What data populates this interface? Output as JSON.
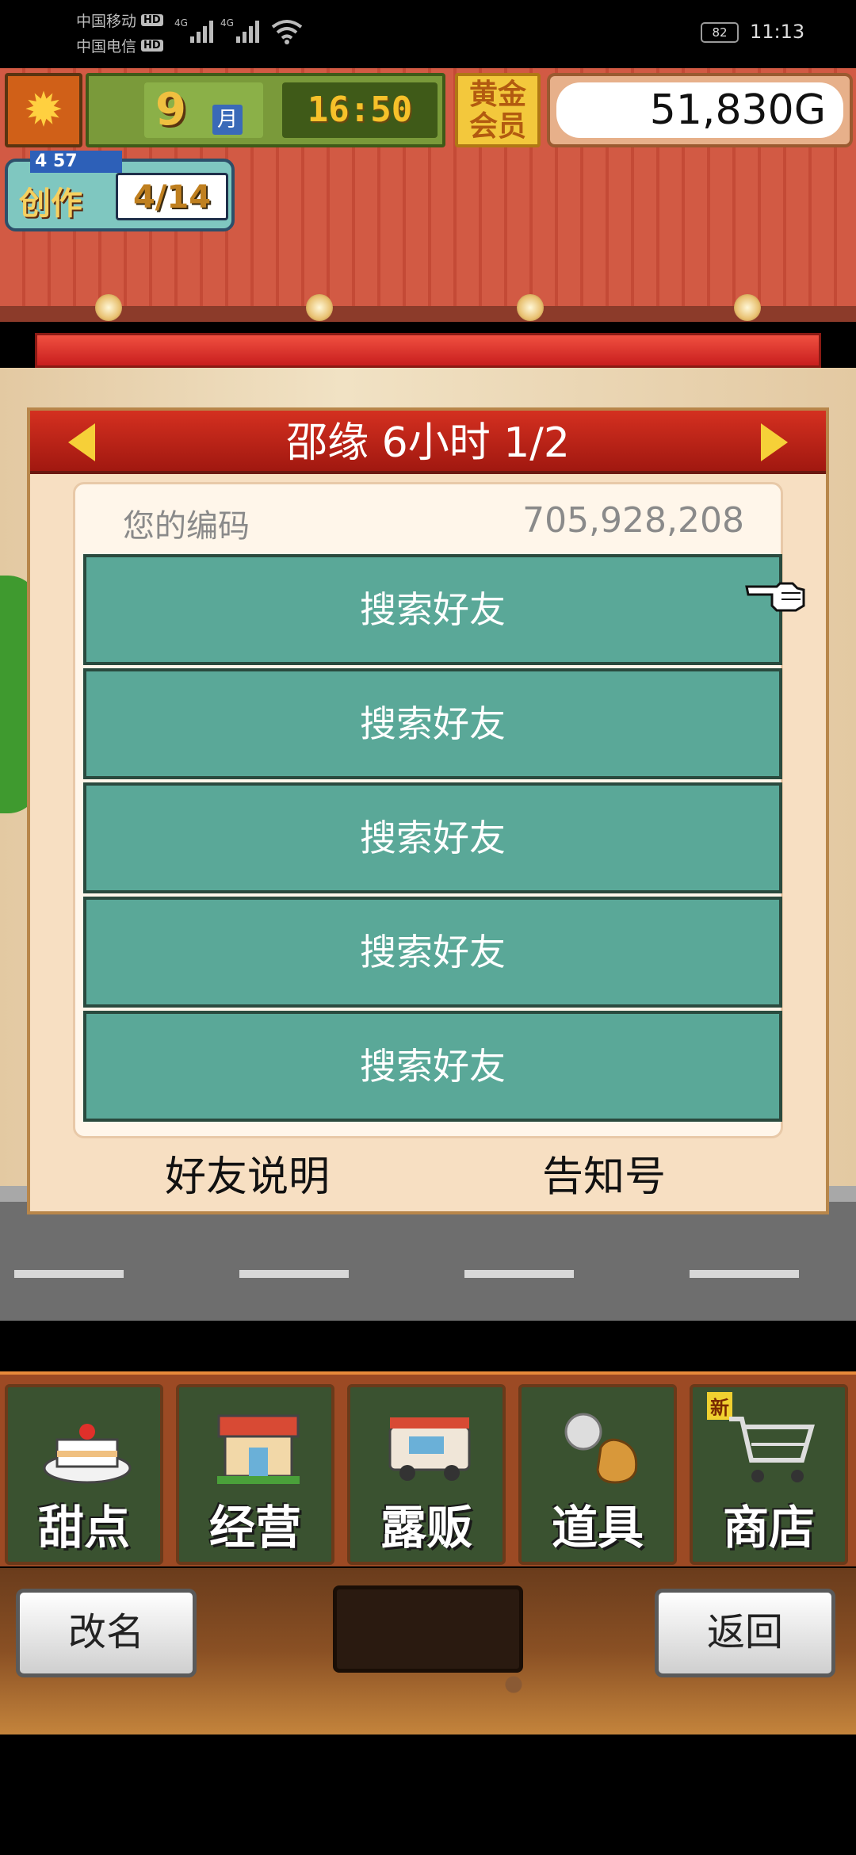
{
  "status_bar": {
    "carrier1": "中国移动",
    "carrier2": "中国电信",
    "hd": "HD",
    "net1": "4G",
    "net2": "4G",
    "battery": "82",
    "time": "11:13"
  },
  "hud": {
    "month_number": "9",
    "month_label": "月",
    "time": "16:50",
    "gold_member": "黄金会员",
    "money": "51,830",
    "currency": "G",
    "create_level": "4 57",
    "create_label": "创作",
    "create_count": "4/14"
  },
  "dialog": {
    "title": "邵缘  6小时 1/2",
    "code_label": "您的编码",
    "code_value": "705,928,208",
    "slots": [
      "搜索好友",
      "搜索好友",
      "搜索好友",
      "搜索好友",
      "搜索好友"
    ],
    "friend_info": "好友说明",
    "notice": "告知号"
  },
  "menu": {
    "items": [
      {
        "label": "甜点",
        "icon": "cake-icon"
      },
      {
        "label": "经营",
        "icon": "shop-icon"
      },
      {
        "label": "露贩",
        "icon": "food-truck-icon"
      },
      {
        "label": "道具",
        "icon": "items-bag-icon"
      },
      {
        "label": "商店",
        "icon": "cart-icon",
        "badge": "新"
      }
    ]
  },
  "bottom": {
    "rename": "改名",
    "back": "返回"
  },
  "colors": {
    "slot_teal": "#5aa898",
    "header_red": "#c42418",
    "dialog_bg": "#f7dfc2"
  }
}
